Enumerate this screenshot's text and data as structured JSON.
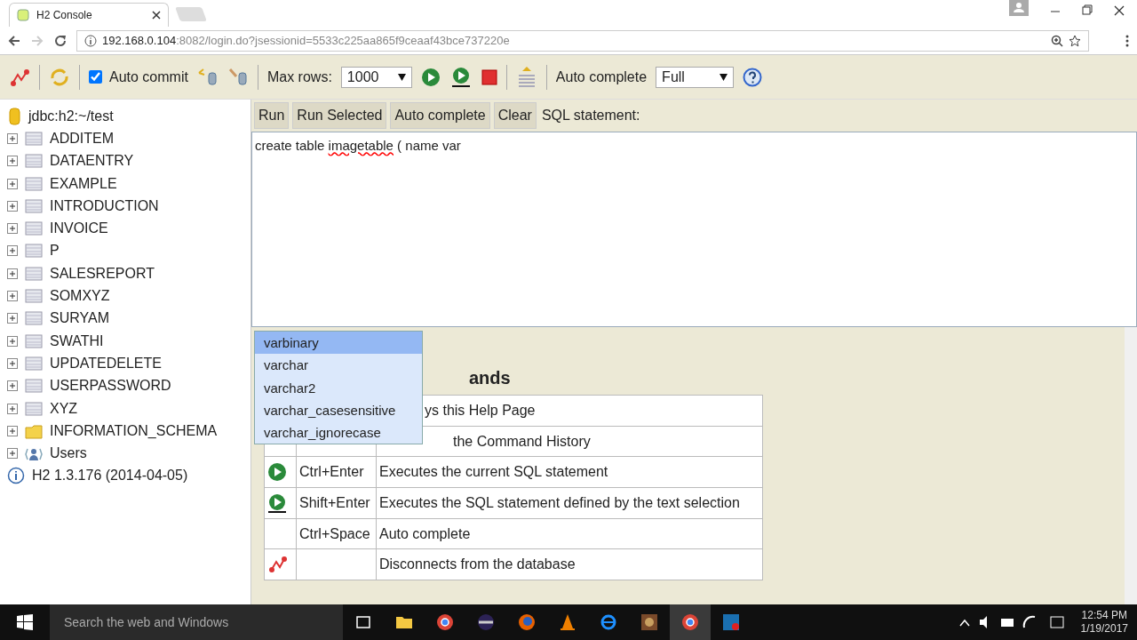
{
  "browser": {
    "tab_title": "H2 Console",
    "url_host": "192.168.0.104",
    "url_rest": ":8082/login.do?jsessionid=5533c225aa865f9ceaaf43bce737220e"
  },
  "toolbar": {
    "auto_commit": {
      "label": "Auto commit",
      "checked": true
    },
    "max_rows": {
      "label": "Max rows:",
      "value": "1000"
    },
    "auto_complete": {
      "label": "Auto complete",
      "value": "Full"
    }
  },
  "sidebar": {
    "connection": "jdbc:h2:~/test",
    "items": [
      {
        "label": "ADDITEM",
        "kind": "table",
        "expanded": false
      },
      {
        "label": "DATAENTRY",
        "kind": "table",
        "expanded": false
      },
      {
        "label": "EXAMPLE",
        "kind": "table",
        "expanded": false
      },
      {
        "label": "INTRODUCTION",
        "kind": "table",
        "expanded": false
      },
      {
        "label": "INVOICE",
        "kind": "table",
        "expanded": false
      },
      {
        "label": "P",
        "kind": "table",
        "expanded": false
      },
      {
        "label": "SALESREPORT",
        "kind": "table",
        "expanded": false
      },
      {
        "label": "SOMXYZ",
        "kind": "table",
        "expanded": false
      },
      {
        "label": "SURYAM",
        "kind": "table",
        "expanded": false
      },
      {
        "label": "SWATHI",
        "kind": "table",
        "expanded": false
      },
      {
        "label": "UPDATEDELETE",
        "kind": "table",
        "expanded": false
      },
      {
        "label": "USERPASSWORD",
        "kind": "table",
        "expanded": false
      },
      {
        "label": "XYZ",
        "kind": "table",
        "expanded": false
      },
      {
        "label": "INFORMATION_SCHEMA",
        "kind": "folder",
        "expanded": false
      },
      {
        "label": "Users",
        "kind": "users",
        "expanded": false
      }
    ],
    "version": "H2 1.3.176 (2014-04-05)"
  },
  "sql_buttons": [
    "Run",
    "Run Selected",
    "Auto complete",
    "Clear"
  ],
  "sql_label": "SQL statement:",
  "editor": {
    "segments": [
      {
        "text": "create table "
      },
      {
        "text": "imagetable",
        "misspelled": true
      },
      {
        "text": " ( name var"
      }
    ]
  },
  "autocomplete": [
    {
      "label": "varbinary",
      "selected": true
    },
    {
      "label": "varchar",
      "selected": false
    },
    {
      "label": "varchar2",
      "selected": false
    },
    {
      "label": "varchar_casesensitive",
      "selected": false
    },
    {
      "label": "varchar_ignorecase",
      "selected": false
    }
  ],
  "help": {
    "heading": "ands",
    "rows": [
      {
        "kind": "plain",
        "description": "ys this Help Page"
      },
      {
        "kind": "plain",
        "description": "the Command History"
      },
      {
        "kind": "run",
        "key": "Ctrl+Enter",
        "description": "Executes the current SQL statement"
      },
      {
        "kind": "run_selected",
        "key": "Shift+Enter",
        "description": "Executes the SQL statement defined by the text selection"
      },
      {
        "kind": "plain",
        "key": "Ctrl+Space",
        "description": "Auto complete"
      },
      {
        "kind": "disconnect",
        "description": "Disconnects from the database"
      }
    ]
  },
  "taskbar": {
    "search": "Search the web and Windows",
    "time": "12:54 PM",
    "date": "1/19/2017"
  }
}
